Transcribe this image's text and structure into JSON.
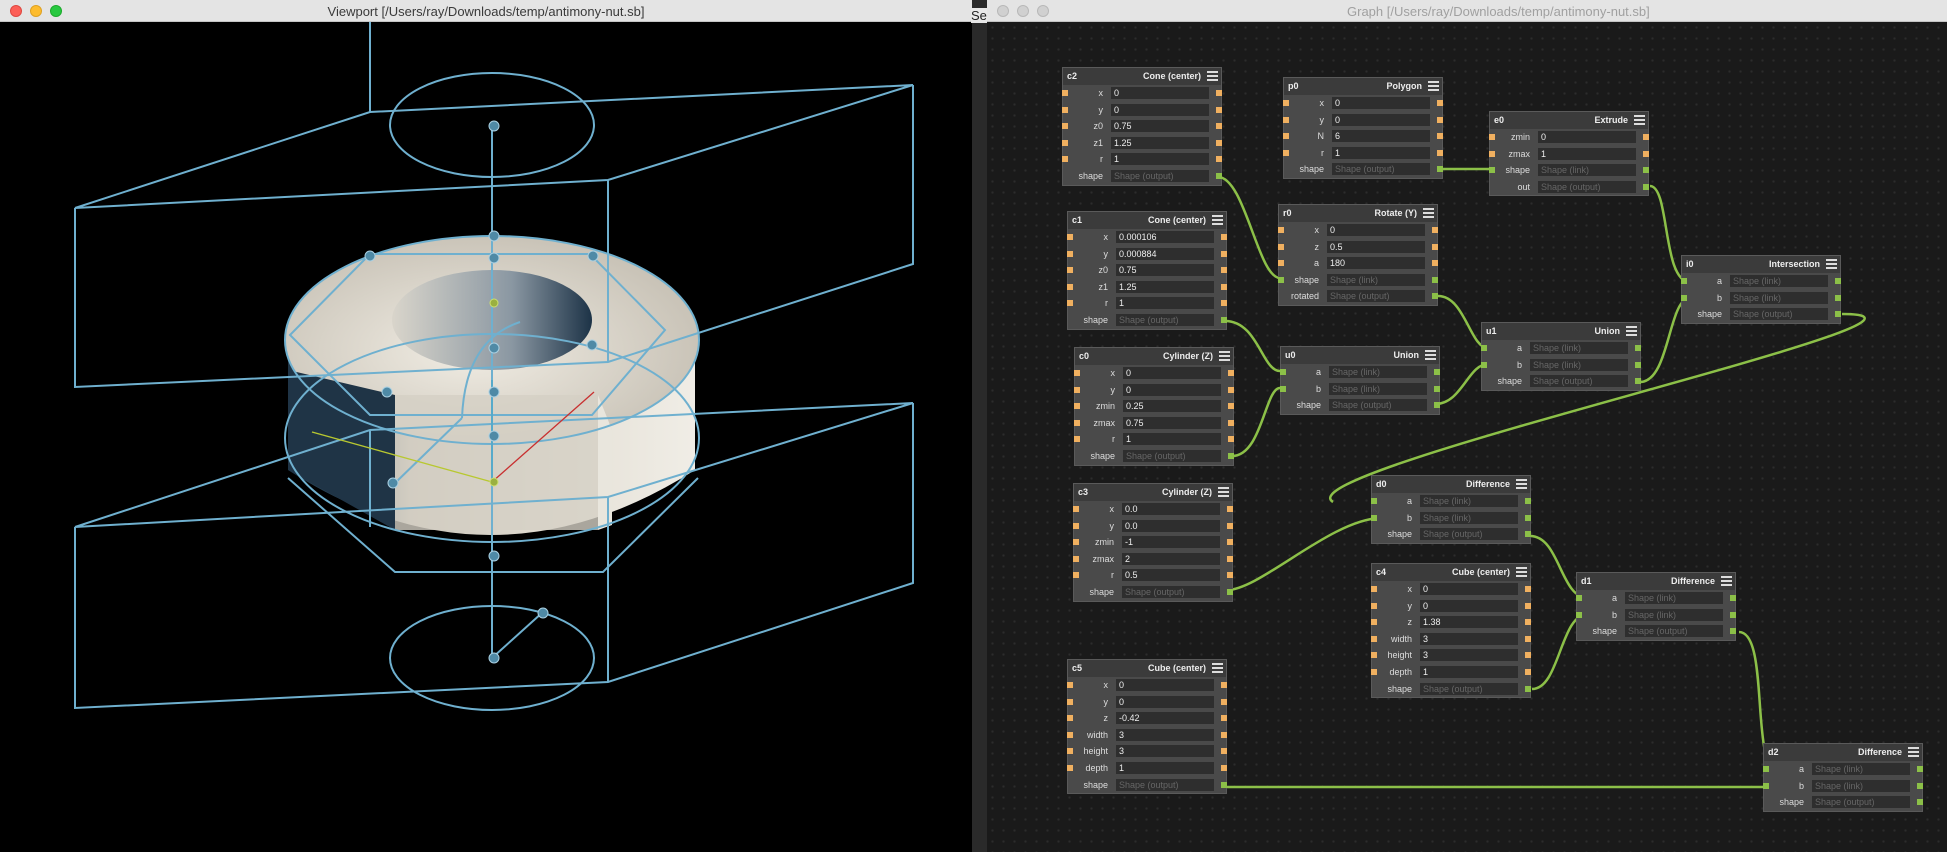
{
  "viewport": {
    "title": "Viewport [/Users/ray/Downloads/temp/antimony-nut.sb]",
    "colors": {
      "wireframe": "#6fb0cf",
      "background": "#000000",
      "hex_face": "#d8d4c8"
    }
  },
  "gap_label": "Se",
  "graph": {
    "title": "Graph [/Users/ray/Downloads/temp/antimony-nut.sb]",
    "nodes": {
      "c2": {
        "id": "c2",
        "type": "Cone (center)",
        "rows": [
          {
            "label": "x",
            "value": "0"
          },
          {
            "label": "y",
            "value": "0"
          },
          {
            "label": "z0",
            "value": "0.75"
          },
          {
            "label": "z1",
            "value": "1.25"
          },
          {
            "label": "r",
            "value": "1"
          },
          {
            "label": "shape",
            "placeholder": "Shape (output)"
          }
        ]
      },
      "c1": {
        "id": "c1",
        "type": "Cone (center)",
        "rows": [
          {
            "label": "x",
            "value": "0.000106"
          },
          {
            "label": "y",
            "value": "0.000884"
          },
          {
            "label": "z0",
            "value": "0.75"
          },
          {
            "label": "z1",
            "value": "1.25"
          },
          {
            "label": "r",
            "value": "1"
          },
          {
            "label": "shape",
            "placeholder": "Shape (output)"
          }
        ]
      },
      "c0": {
        "id": "c0",
        "type": "Cylinder (Z)",
        "rows": [
          {
            "label": "x",
            "value": "0"
          },
          {
            "label": "y",
            "value": "0"
          },
          {
            "label": "zmin",
            "value": "0.25"
          },
          {
            "label": "zmax",
            "value": "0.75"
          },
          {
            "label": "r",
            "value": "1"
          },
          {
            "label": "shape",
            "placeholder": "Shape (output)"
          }
        ]
      },
      "c3": {
        "id": "c3",
        "type": "Cylinder (Z)",
        "rows": [
          {
            "label": "x",
            "value": "0.0"
          },
          {
            "label": "y",
            "value": "0.0"
          },
          {
            "label": "zmin",
            "value": "-1"
          },
          {
            "label": "zmax",
            "value": "2"
          },
          {
            "label": "r",
            "value": "0.5"
          },
          {
            "label": "shape",
            "placeholder": "Shape (output)"
          }
        ]
      },
      "c5": {
        "id": "c5",
        "type": "Cube (center)",
        "rows": [
          {
            "label": "x",
            "value": "0"
          },
          {
            "label": "y",
            "value": "0"
          },
          {
            "label": "z",
            "value": "-0.42"
          },
          {
            "label": "width",
            "value": "3"
          },
          {
            "label": "height",
            "value": "3"
          },
          {
            "label": "depth",
            "value": "1"
          },
          {
            "label": "shape",
            "placeholder": "Shape (output)"
          }
        ]
      },
      "p0": {
        "id": "p0",
        "type": "Polygon",
        "rows": [
          {
            "label": "x",
            "value": "0"
          },
          {
            "label": "y",
            "value": "0"
          },
          {
            "label": "N",
            "value": "6"
          },
          {
            "label": "r",
            "value": "1"
          },
          {
            "label": "shape",
            "placeholder": "Shape (output)"
          }
        ]
      },
      "r0": {
        "id": "r0",
        "type": "Rotate (Y)",
        "rows": [
          {
            "label": "x",
            "value": "0"
          },
          {
            "label": "z",
            "value": "0.5"
          },
          {
            "label": "a",
            "value": "180"
          },
          {
            "label": "shape",
            "placeholder": "Shape (link)"
          },
          {
            "label": "rotated",
            "placeholder": "Shape (output)"
          }
        ]
      },
      "u0": {
        "id": "u0",
        "type": "Union",
        "rows": [
          {
            "label": "a",
            "placeholder": "Shape (link)"
          },
          {
            "label": "b",
            "placeholder": "Shape (link)"
          },
          {
            "label": "shape",
            "placeholder": "Shape (output)"
          }
        ]
      },
      "e0": {
        "id": "e0",
        "type": "Extrude",
        "rows": [
          {
            "label": "zmin",
            "value": "0"
          },
          {
            "label": "zmax",
            "value": "1"
          },
          {
            "label": "shape",
            "placeholder": "Shape (link)"
          },
          {
            "label": "out",
            "placeholder": "Shape (output)"
          }
        ]
      },
      "u1": {
        "id": "u1",
        "type": "Union",
        "rows": [
          {
            "label": "a",
            "placeholder": "Shape (link)"
          },
          {
            "label": "b",
            "placeholder": "Shape (link)"
          },
          {
            "label": "shape",
            "placeholder": "Shape (output)"
          }
        ]
      },
      "i0": {
        "id": "i0",
        "type": "Intersection",
        "rows": [
          {
            "label": "a",
            "placeholder": "Shape (link)"
          },
          {
            "label": "b",
            "placeholder": "Shape (link)"
          },
          {
            "label": "shape",
            "placeholder": "Shape (output)"
          }
        ]
      },
      "d0": {
        "id": "d0",
        "type": "Difference",
        "rows": [
          {
            "label": "a",
            "placeholder": "Shape (link)"
          },
          {
            "label": "b",
            "placeholder": "Shape (link)"
          },
          {
            "label": "shape",
            "placeholder": "Shape (output)"
          }
        ]
      },
      "c4": {
        "id": "c4",
        "type": "Cube (center)",
        "rows": [
          {
            "label": "x",
            "value": "0"
          },
          {
            "label": "y",
            "value": "0"
          },
          {
            "label": "z",
            "value": "1.38"
          },
          {
            "label": "width",
            "value": "3"
          },
          {
            "label": "height",
            "value": "3"
          },
          {
            "label": "depth",
            "value": "1"
          },
          {
            "label": "shape",
            "placeholder": "Shape (output)"
          }
        ]
      },
      "d1": {
        "id": "d1",
        "type": "Difference",
        "rows": [
          {
            "label": "a",
            "placeholder": "Shape (link)"
          },
          {
            "label": "b",
            "placeholder": "Shape (link)"
          },
          {
            "label": "shape",
            "placeholder": "Shape (output)"
          }
        ]
      },
      "d2": {
        "id": "d2",
        "type": "Difference",
        "rows": [
          {
            "label": "a",
            "placeholder": "Shape (link)"
          },
          {
            "label": "b",
            "placeholder": "Shape (link)"
          },
          {
            "label": "shape",
            "placeholder": "Shape (output)"
          }
        ]
      }
    },
    "colors": {
      "wire": "#8cc048",
      "number_port": "#f0b060",
      "shape_port": "#8cc048",
      "node_body": "#4a4a4a"
    }
  }
}
